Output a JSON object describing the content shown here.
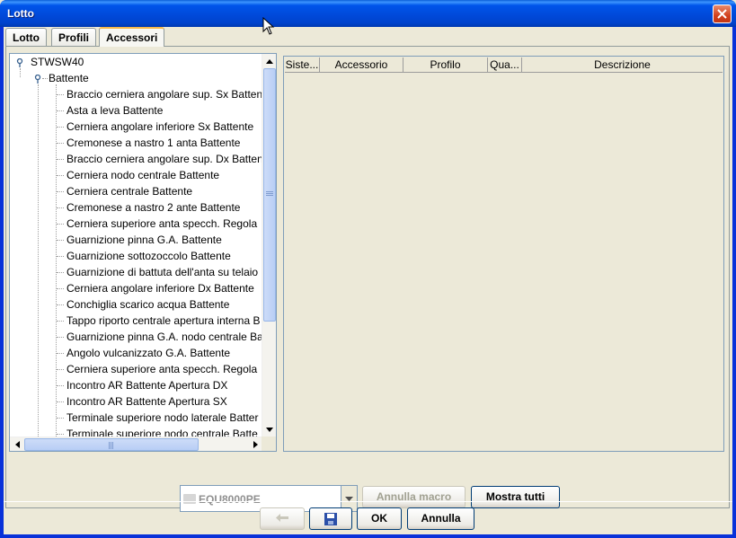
{
  "window": {
    "title": "Lotto"
  },
  "tabs": [
    {
      "label": "Lotto"
    },
    {
      "label": "Profili"
    },
    {
      "label": "Accessori"
    }
  ],
  "tree": {
    "root": "STWSW40",
    "group": "Battente",
    "items": [
      "Braccio cerniera angolare sup. Sx Batten",
      "Asta a leva Battente",
      "Cerniera angolare inferiore Sx Battente",
      "Cremonese a nastro 1 anta Battente",
      "Braccio cerniera angolare sup. Dx Batten",
      "Cerniera nodo centrale Battente",
      "Cerniera centrale Battente",
      "Cremonese a nastro 2 ante Battente",
      "Cerniera superiore anta specch. Regola",
      "Guarnizione pinna G.A. Battente",
      "Guarnizione sottozoccolo Battente",
      "Guarnizione di battuta dell'anta su telaio",
      "Cerniera angolare inferiore Dx Battente",
      "Conchiglia scarico acqua Battente",
      "Tappo riporto centrale apertura interna B",
      "Guarnizione pinna G.A. nodo centrale Ba",
      "Angolo vulcanizzato G.A. Battente",
      "Cerniera superiore anta specch. Regola",
      "Incontro AR Battente Apertura DX",
      "Incontro AR Battente Apertura SX",
      "Terminale superiore nodo laterale Batter",
      "Terminale superiore nodo centrale Batte"
    ]
  },
  "table": {
    "columns": [
      "Siste...",
      "Accessorio",
      "Profilo",
      "Qua...",
      "Descrizione"
    ],
    "rows": []
  },
  "controls": {
    "combo_value": "EQU8000PE",
    "annulla_macro": "Annulla macro",
    "mostra_tutti": "Mostra tutti"
  },
  "footer": {
    "ok": "OK",
    "annulla": "Annulla"
  }
}
